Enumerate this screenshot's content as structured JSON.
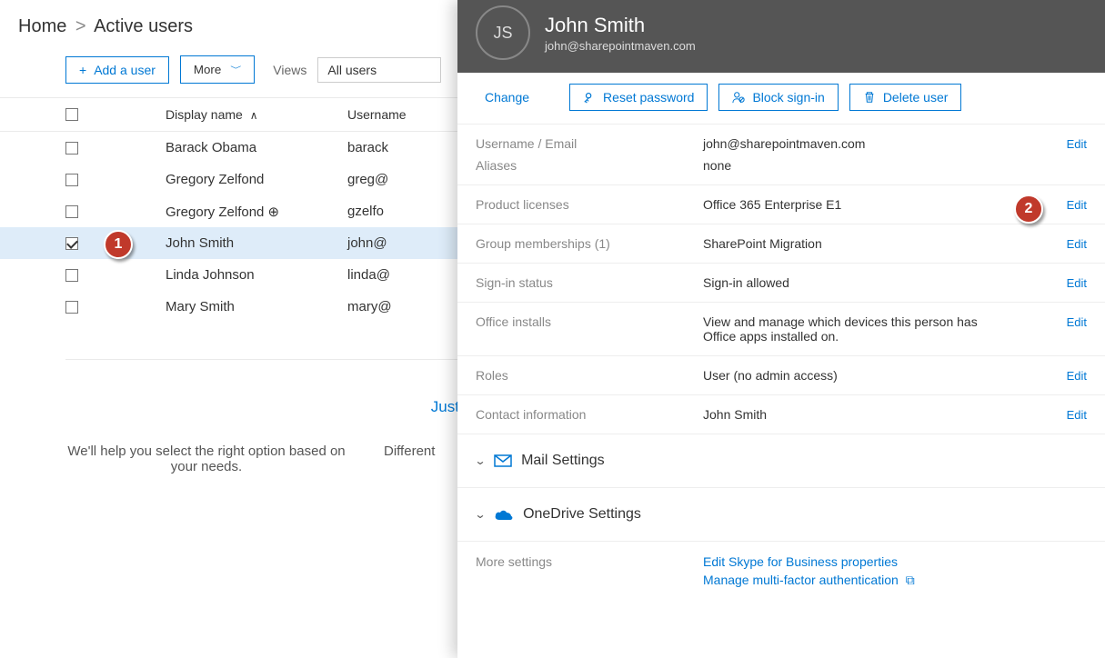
{
  "breadcrumb": {
    "home": "Home",
    "current": "Active users"
  },
  "toolbar": {
    "addUser": "Add a user",
    "more": "More",
    "viewsLabel": "Views",
    "viewsValue": "All users"
  },
  "columns": {
    "displayName": "Display name",
    "username": "Username"
  },
  "users": [
    {
      "name": "Barack Obama",
      "user": "barack",
      "checked": false
    },
    {
      "name": "Gregory Zelfond",
      "user": "greg@",
      "checked": false
    },
    {
      "name": "Gregory Zelfond ⊕",
      "user": "gzelfo",
      "checked": false
    },
    {
      "name": "John Smith",
      "user": "john@",
      "checked": true
    },
    {
      "name": "Linda Johnson",
      "user": "linda@",
      "checked": false
    },
    {
      "name": "Mary Smith",
      "user": "mary@",
      "checked": false
    }
  ],
  "promo": {
    "title": "Just want to add an email address?",
    "text1": "We'll help you select the right option based on your needs.",
    "text2": "Different"
  },
  "panel": {
    "initials": "JS",
    "name": "John Smith",
    "email": "john@sharepointmaven.com",
    "changeLink": "Change",
    "resetPassword": "Reset password",
    "blockSignIn": "Block sign-in",
    "deleteUser": "Delete user",
    "editLabel": "Edit"
  },
  "props": {
    "usernameLabel": "Username / Email",
    "usernameValue": "john@sharepointmaven.com",
    "aliasesLabel": "Aliases",
    "aliasesValue": "none",
    "licensesLabel": "Product licenses",
    "licensesValue": "Office 365 Enterprise E1",
    "groupsLabel": "Group memberships (1)",
    "groupsValue": "SharePoint Migration",
    "signinLabel": "Sign-in status",
    "signinValue": "Sign-in allowed",
    "officeLabel": "Office installs",
    "officeValue": "View and manage which devices this person has Office apps installed on.",
    "rolesLabel": "Roles",
    "rolesValue": "User (no admin access)",
    "contactLabel": "Contact information",
    "contactValue": "John Smith"
  },
  "sections": {
    "mail": "Mail Settings",
    "onedrive": "OneDrive Settings"
  },
  "moreSettings": {
    "label": "More settings",
    "skype": "Edit Skype for Business properties",
    "mfa": "Manage multi-factor authentication"
  },
  "callouts": {
    "one": "1",
    "two": "2"
  }
}
